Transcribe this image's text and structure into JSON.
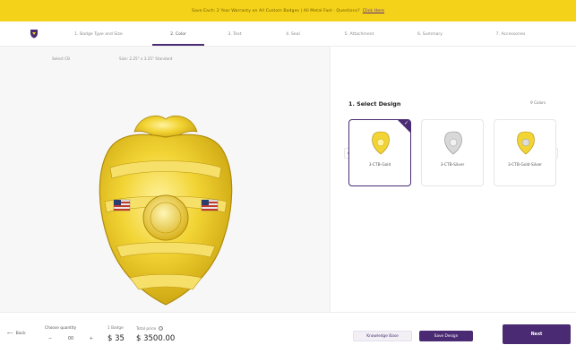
{
  "banner": {
    "text": "Save Each: 2 Year Warranty on All Custom Badges | All Metal Fast · Questions?",
    "link": "Click Here",
    "bg_color": "#f5d21a"
  },
  "steps": [
    {
      "label": "1. Badge Type and Size",
      "active": false
    },
    {
      "label": "2. Color",
      "active": true
    },
    {
      "label": "3. Text",
      "active": false
    },
    {
      "label": "4. Seal",
      "active": false
    },
    {
      "label": "5. Attachment",
      "active": false
    },
    {
      "label": "6. Summary",
      "active": false
    },
    {
      "label": "7. Accessories",
      "active": false
    }
  ],
  "preview": {
    "select_label": "Select CB",
    "size_label": "Size: 2.25\" x 3.25\" Standard"
  },
  "design": {
    "title": "1. Select Design",
    "count": "9 Colors",
    "cards": [
      {
        "label": "3-CTB-Gold",
        "selected": true,
        "tone": "gold"
      },
      {
        "label": "3-CTB-Silver",
        "selected": false,
        "tone": "silver"
      },
      {
        "label": "3-CTB-Gold-Silver",
        "selected": false,
        "tone": "gold-silver"
      }
    ]
  },
  "bottom": {
    "back": "Back",
    "quantity_label": "Choose quantity",
    "quantity": "00",
    "unit_label": "1 Badge",
    "total_label": "Total price",
    "unit_price": "$ 35",
    "total_price": "$ 3500.00",
    "knowledge_button": "Knowledge Base",
    "save_button": "Save Design",
    "next_button": "Next"
  },
  "colors": {
    "accent": "#4a2b73",
    "badge_gold": "#f2d434"
  }
}
